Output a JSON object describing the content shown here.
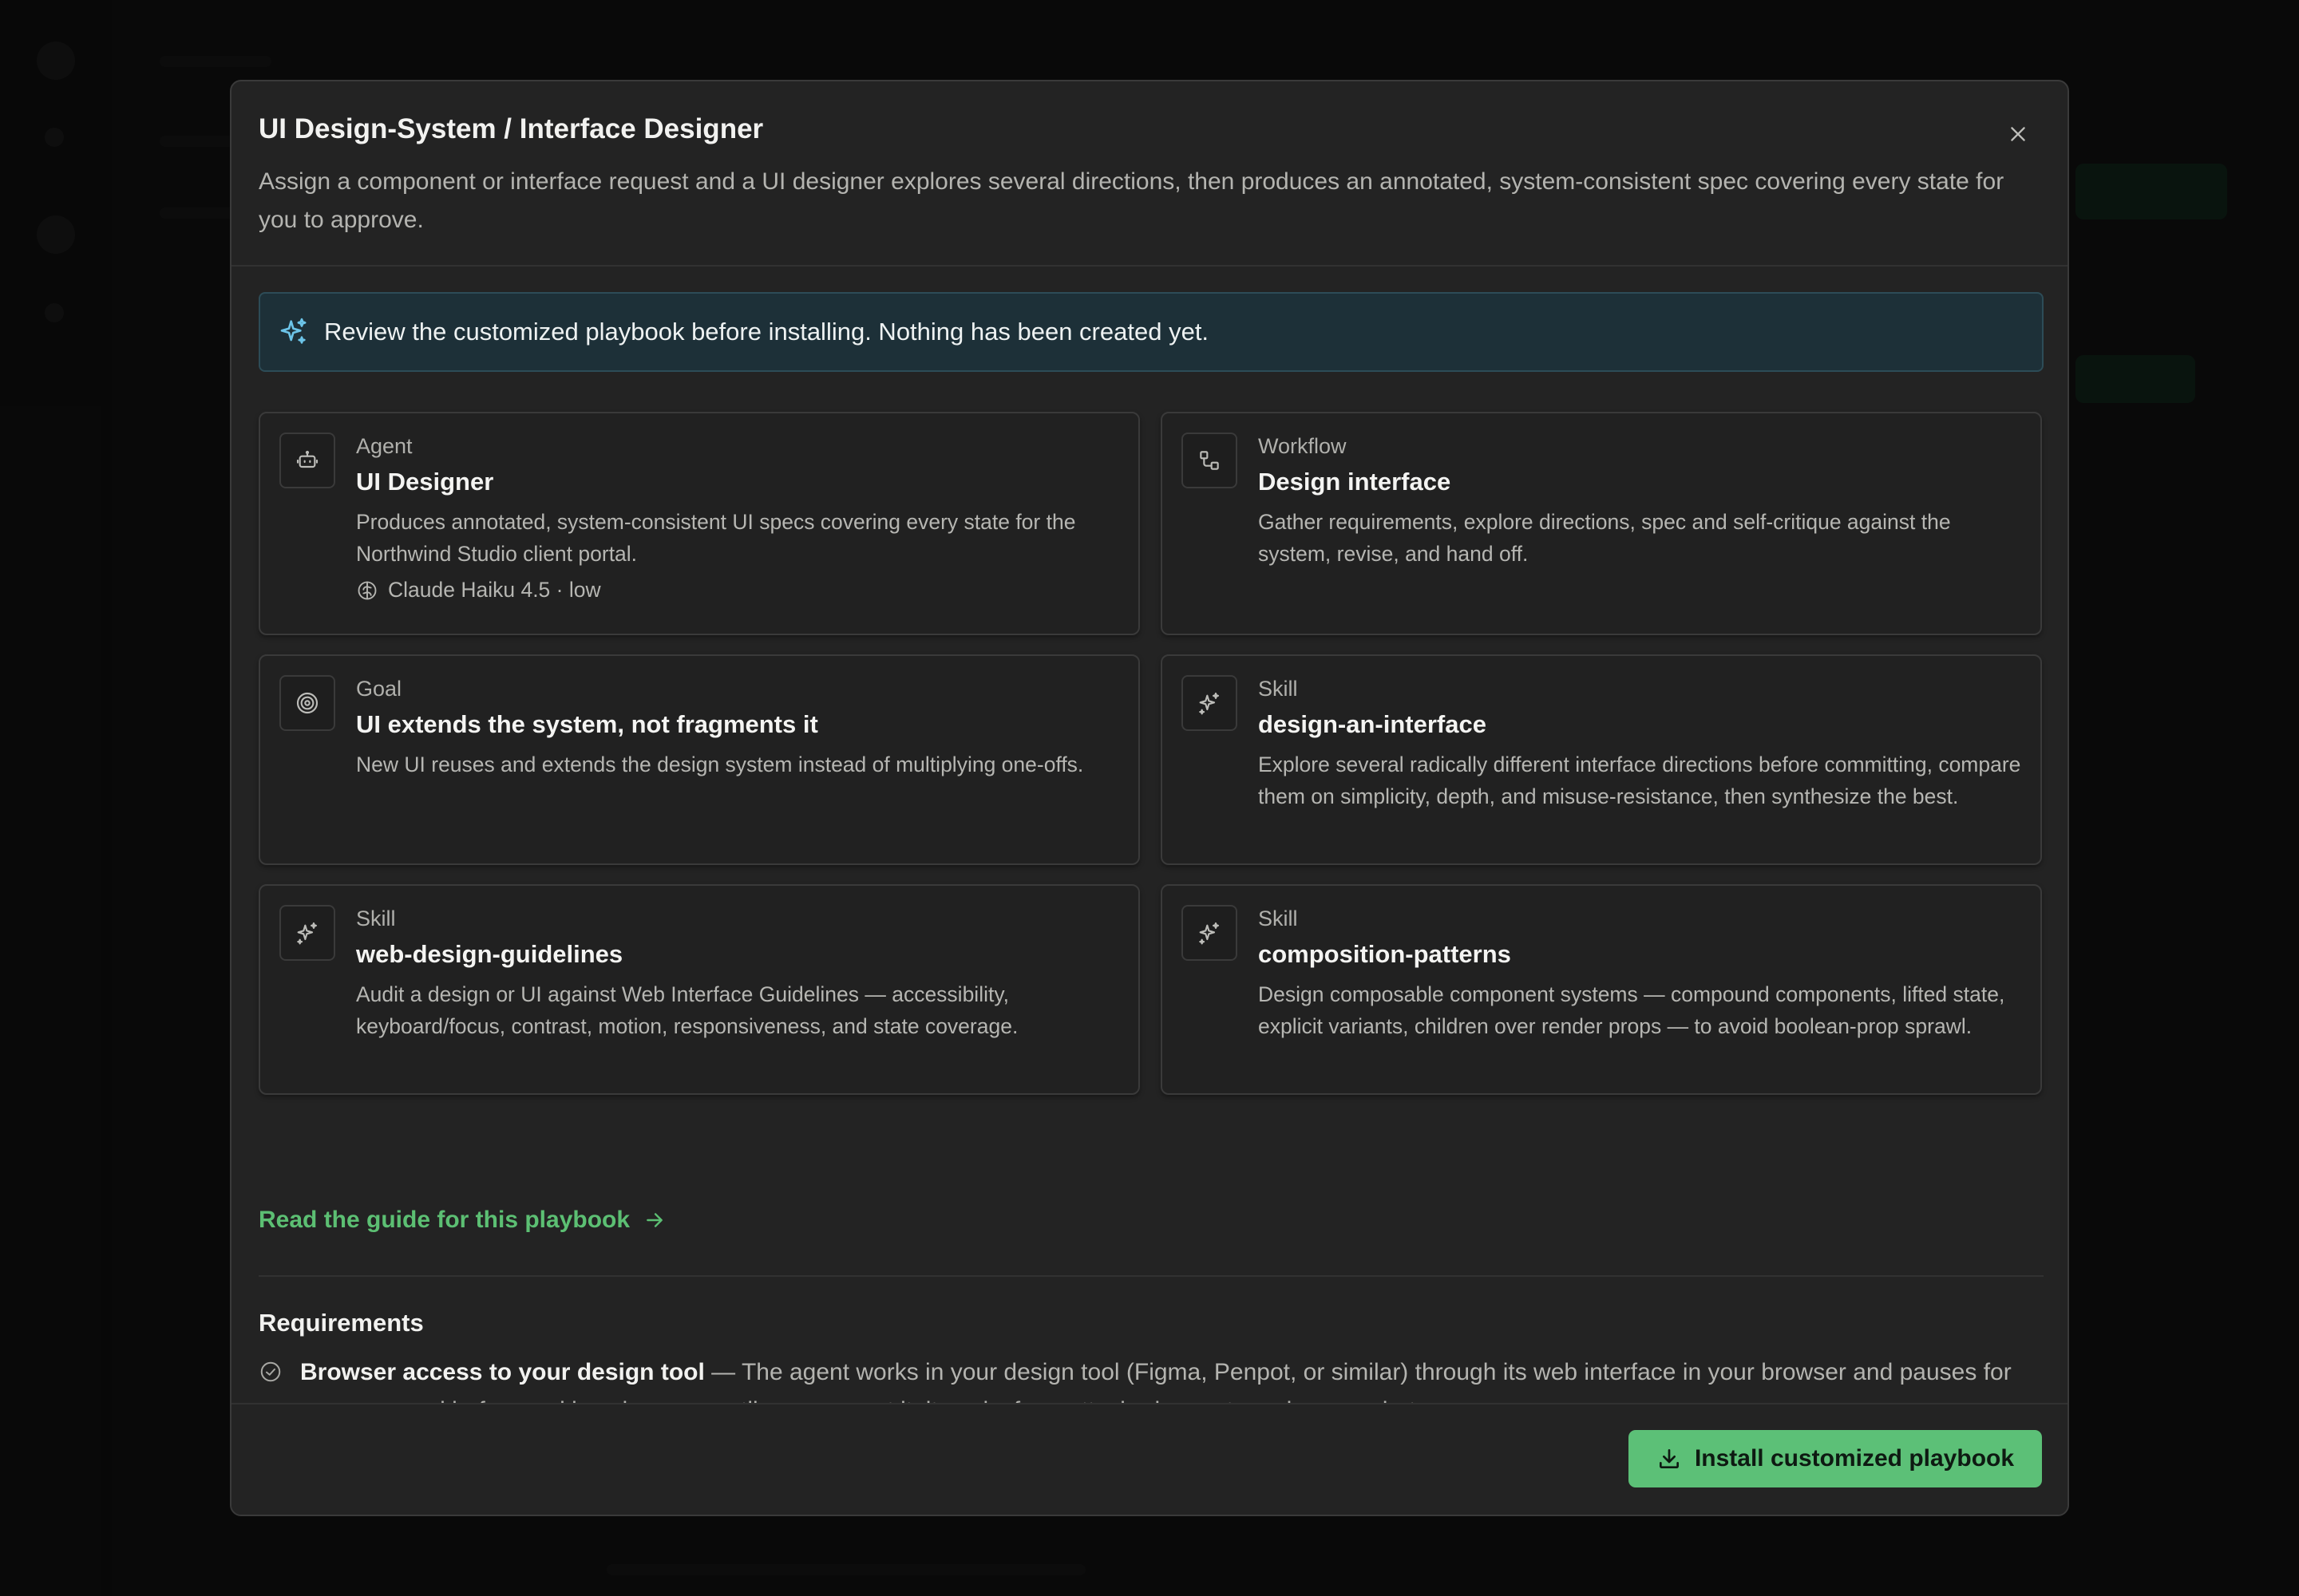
{
  "modal": {
    "title": "UI Design-System / Interface Designer",
    "description": "Assign a component or interface request and a UI designer explores several directions, then produces an annotated, system-consistent spec covering every state for you to approve."
  },
  "notice": {
    "text": "Review the customized playbook before installing. Nothing has been created yet."
  },
  "cards": [
    {
      "kind": "Agent",
      "name": "UI Designer",
      "description": "Produces annotated, system-consistent UI specs covering every state for the Northwind Studio client portal.",
      "model": "Claude Haiku 4.5 · low",
      "icon": "robot-icon"
    },
    {
      "kind": "Workflow",
      "name": "Design interface",
      "description": "Gather requirements, explore directions, spec and self-critique against the system, revise, and hand off.",
      "icon": "workflow-icon"
    },
    {
      "kind": "Goal",
      "name": "UI extends the system, not fragments it",
      "description": "New UI reuses and extends the design system instead of multiplying one-offs.",
      "icon": "target-icon"
    },
    {
      "kind": "Skill",
      "name": "design-an-interface",
      "description": "Explore several radically different interface directions before committing, compare them on simplicity, depth, and misuse-resistance, then synthesize the best.",
      "icon": "sparkles-icon"
    },
    {
      "kind": "Skill",
      "name": "web-design-guidelines",
      "description": "Audit a design or UI against Web Interface Guidelines — accessibility, keyboard/focus, contrast, motion, responsiveness, and state coverage.",
      "icon": "sparkles-icon"
    },
    {
      "kind": "Skill",
      "name": "composition-patterns",
      "description": "Design composable component systems — compound components, lifted state, explicit variants, children over render props — to avoid boolean-prop sprawl.",
      "icon": "sparkles-icon"
    }
  ],
  "guide_link": "Read the guide for this playbook",
  "requirements": {
    "title": "Requirements",
    "items": [
      {
        "name": "Browser access to your design tool",
        "text": " — The agent works in your design tool (Figma, Penpot, or similar) through its web interface in your browser and pauses for your approval before making changes; until you connect it, it works from attached exports and screenshots."
      }
    ]
  },
  "footer": {
    "install_label": "Install customized playbook"
  },
  "colors": {
    "accent_green": "#5cc077",
    "notice_bg": "#1d3038",
    "modal_bg": "#232323"
  }
}
